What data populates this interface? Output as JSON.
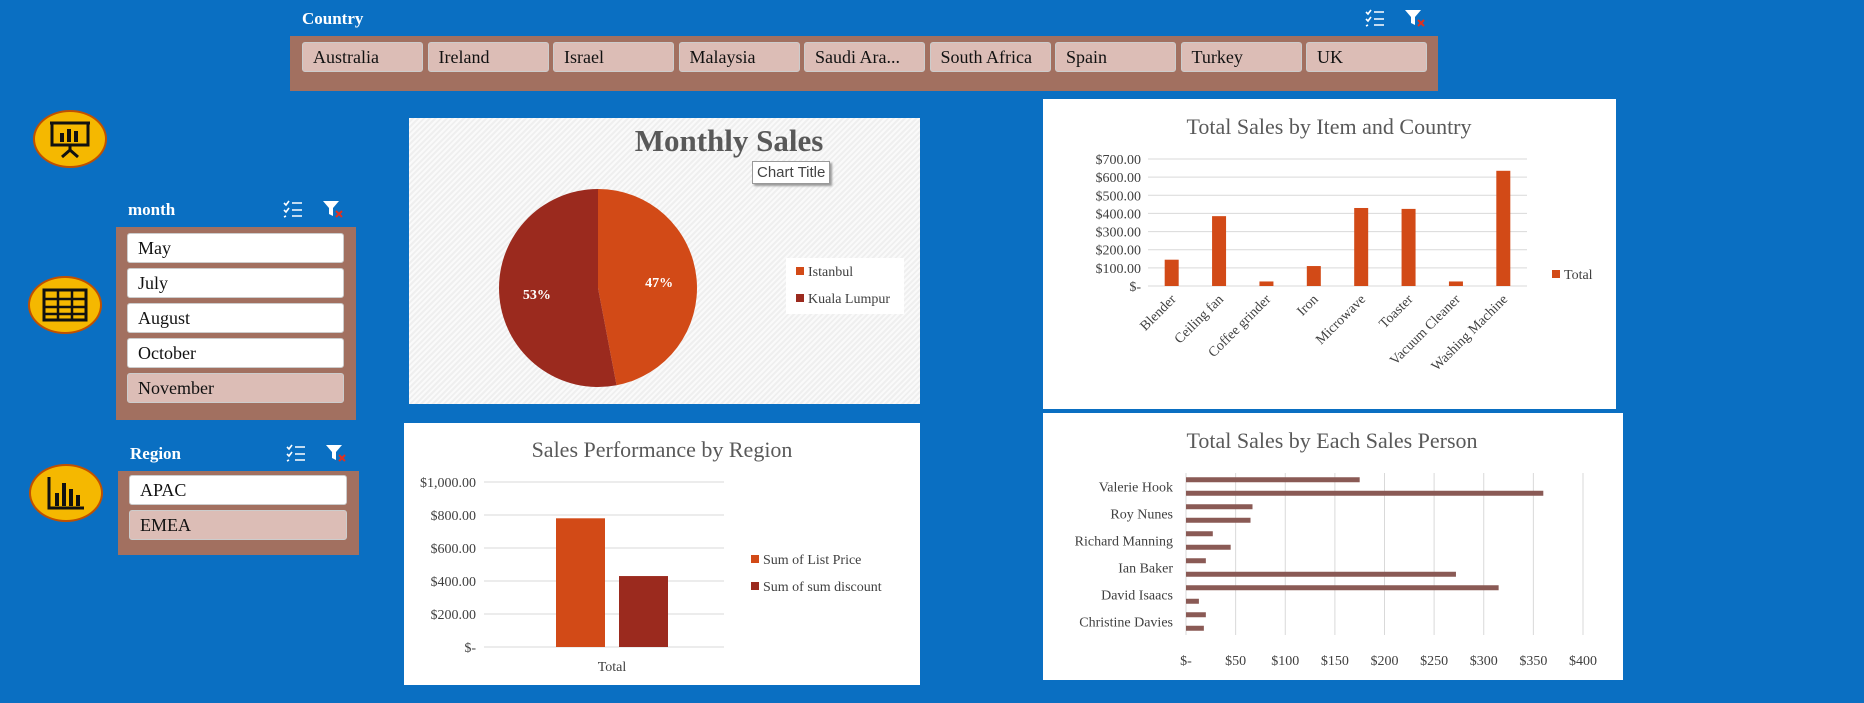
{
  "country_slicer": {
    "title": "Country",
    "items": [
      {
        "label": "Australia"
      },
      {
        "label": "Ireland"
      },
      {
        "label": "Israel"
      },
      {
        "label": "Malaysia"
      },
      {
        "label": "Saudi Ara..."
      },
      {
        "label": "South Africa"
      },
      {
        "label": "Spain"
      },
      {
        "label": "Turkey"
      },
      {
        "label": "UK"
      }
    ]
  },
  "month_slicer": {
    "title": "month",
    "items": [
      {
        "label": "May",
        "selected": true
      },
      {
        "label": "July",
        "selected": true
      },
      {
        "label": "August",
        "selected": true
      },
      {
        "label": "October",
        "selected": true
      },
      {
        "label": "November",
        "selected": false
      }
    ]
  },
  "region_slicer": {
    "title": "Region",
    "items": [
      {
        "label": "APAC",
        "selected": true
      },
      {
        "label": "EMEA",
        "selected": false
      }
    ]
  },
  "nav_icons": [
    "presentation-icon",
    "table-icon",
    "bar-chart-icon"
  ],
  "colors": {
    "background": "#0a6fc2",
    "slicer": "#a27060",
    "series1": "#d24a17",
    "series2": "#9b2a1e",
    "bar": "#8a5a55",
    "accent": "#f5b800"
  },
  "chart_tooltip": "Chart Title",
  "chart_data": [
    {
      "type": "pie",
      "title": "Monthly Sales",
      "categories": [
        "Istanbul",
        "Kuala Lumpur"
      ],
      "values": [
        47,
        53
      ],
      "data_labels": [
        "47%",
        "53%"
      ],
      "legend": "right"
    },
    {
      "type": "bar",
      "title": "Total Sales by Item and Country",
      "categories": [
        "Blender",
        "Ceiling fan",
        "Coffee grinder",
        "Iron",
        "Microwave",
        "Toaster",
        "Vacuum Cleaner",
        "Washing Machine"
      ],
      "series": [
        {
          "name": "Total",
          "values": [
            145,
            385,
            25,
            110,
            430,
            425,
            25,
            635
          ]
        }
      ],
      "yticks": [
        "$-",
        "$100.00",
        "$200.00",
        "$300.00",
        "$400.00",
        "$500.00",
        "$600.00",
        "$700.00"
      ],
      "ylim": [
        0,
        700
      ],
      "legend": "right"
    },
    {
      "type": "bar",
      "title": "Sales Performance by Region",
      "categories": [
        "Total"
      ],
      "series": [
        {
          "name": "Sum of List Price",
          "values": [
            780
          ]
        },
        {
          "name": "Sum of sum discount",
          "values": [
            430
          ]
        }
      ],
      "yticks": [
        "$-",
        "$200.00",
        "$400.00",
        "$600.00",
        "$800.00",
        "$1,000.00"
      ],
      "ylim": [
        0,
        1000
      ],
      "legend": "right"
    },
    {
      "type": "bar",
      "orientation": "horizontal",
      "title": "Total Sales by Each Sales Person",
      "row_labels": [
        "Valerie Hook",
        "Roy Nunes",
        "Richard Manning",
        "Ian Baker",
        "David Isaacs",
        "Christine Davies"
      ],
      "values": [
        175,
        360,
        67,
        65,
        27,
        45,
        20,
        272,
        315,
        13,
        20,
        18
      ],
      "xticks": [
        "$-",
        "$50",
        "$100",
        "$150",
        "$200",
        "$250",
        "$300",
        "$350",
        "$400"
      ],
      "xlim": [
        0,
        400
      ]
    }
  ]
}
